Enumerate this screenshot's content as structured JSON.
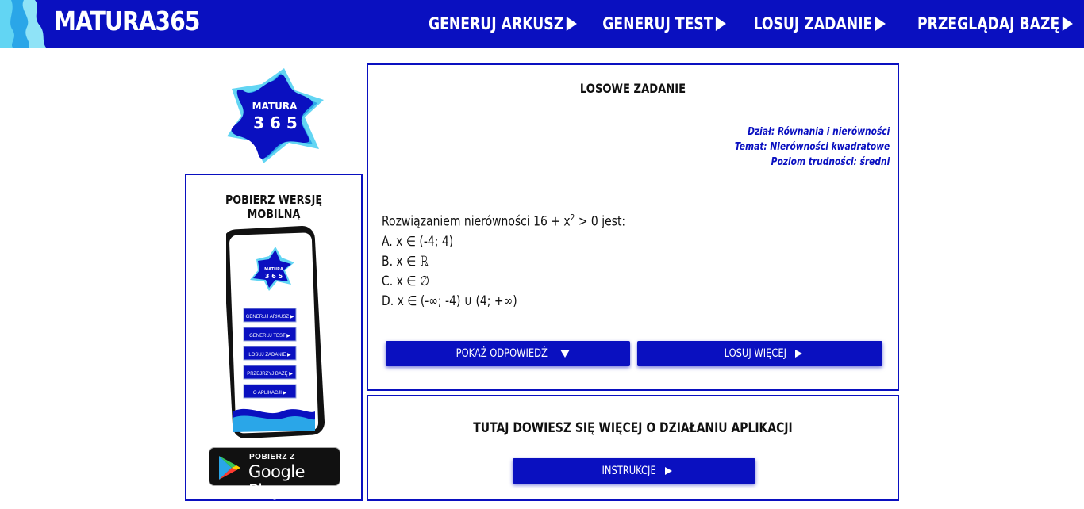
{
  "header": {
    "logo": "MATURA365",
    "nav": [
      {
        "label": "GENERUJ ARKUSZ"
      },
      {
        "label": "GENERUJ TEST"
      },
      {
        "label": "LOSUJ ZADANIE"
      },
      {
        "label": "PRZEGLĄDAJ BAZĘ"
      }
    ]
  },
  "star_logo": {
    "line1": "MATURA",
    "line2": "3 6 5"
  },
  "mobile": {
    "title": "POBIERZ WERSJĘ MOBILNĄ",
    "phone_logo": {
      "line1": "MATURA",
      "line2": "3 6 5"
    },
    "phone_buttons": [
      "GENERUJ ARKUSZ ▶",
      "GENERUJ TEST ▶",
      "LOSUJ ZADANIE ▶",
      "PRZEJRZYJ BAZĘ ▶",
      "O APLIKACJI ▶"
    ],
    "gplay_top": "POBIERZ Z",
    "gplay_main": "Google Play"
  },
  "task": {
    "title": "LOSOWE ZADANIE",
    "dzial": "Dział: Równania i nierówności",
    "temat": "Temat: Nierówności kwadratowe",
    "poziom": "Poziom trudności: średni",
    "question_prefix": "Rozwiązaniem nierówności 16 + x",
    "question_sup": "2",
    "question_suffix": " > 0 jest:",
    "answers": [
      "A. x ∈ (-4; 4)",
      "B. x ∈ ℝ",
      "C. x ∈ ∅",
      "D. x ∈ (-∞; -4) ∪ (4; +∞)"
    ],
    "show_answer": "POKAŻ ODPOWIEDŹ",
    "draw_more": "LOSUJ WIĘCEJ"
  },
  "info": {
    "title": "TUTAJ DOWIESZ SIĘ WIĘCEJ O DZIAŁANIU APLIKACJI",
    "button": "INSTRUKCJE"
  },
  "colors": {
    "brand": "#0a10c0",
    "wave_light": "#62d5f3",
    "wave_mid": "#2aa6e8"
  }
}
